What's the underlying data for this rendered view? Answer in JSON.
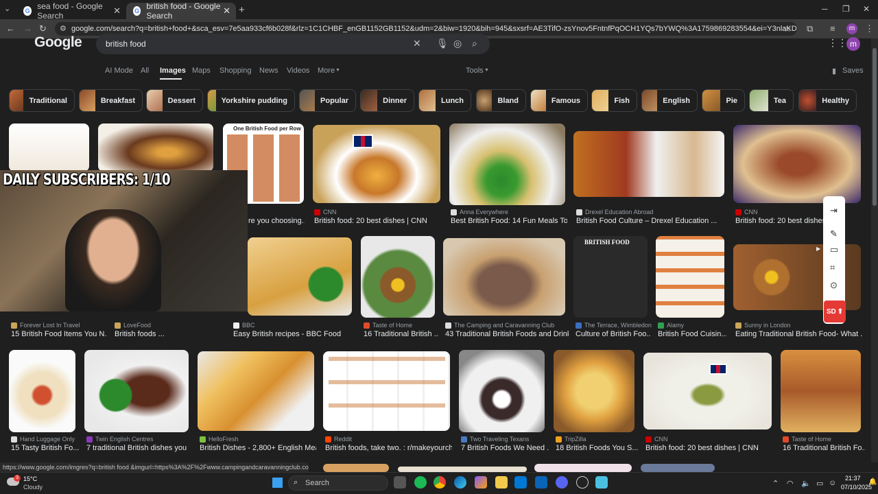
{
  "browser": {
    "tabs": [
      {
        "title": "sea food - Google Search",
        "active": false
      },
      {
        "title": "british food - Google Search",
        "active": true
      }
    ],
    "url": "google.com/search?q=british+food+&sca_esv=7e5aa933cf6b028f&rlz=1C1CHBF_enGB1152GB1152&udm=2&biw=1920&bih=945&sxsrf=AE3TifO-zsYnov5FntnfPqOCH1YQs7bYWQ%3A1759869283554&ei=Y3nlaKDElfKehbIPtYm32Ql&ved=0ahUKE...",
    "profile_initial": "m",
    "status_url": "https://www.google.com/imgres?q=british food &imgurl=https%3A%2F%2Fwww.campingandcaravanningclub.co.uk..."
  },
  "google": {
    "logo": "Google",
    "query": "british food",
    "profile_initial": "m",
    "nav": [
      "AI Mode",
      "All",
      "Images",
      "Maps",
      "Shopping",
      "News",
      "Videos",
      "More"
    ],
    "tools": "Tools",
    "saves": "Saves",
    "chips": [
      "Traditional",
      "Breakfast",
      "Dessert",
      "Yorkshire pudding",
      "Popular",
      "Dinner",
      "Lunch",
      "Bland",
      "Famous",
      "Fish",
      "English",
      "Pie",
      "Tea",
      "Healthy"
    ]
  },
  "results": {
    "row1": [
      {
        "source": "",
        "title": "re you choosing..."
      },
      {
        "source": "CNN",
        "title": "British food: 20 best dishes | CNN"
      },
      {
        "source": "Anna Everywhere",
        "title": "Best British Food: 14 Fun Meals To ..."
      },
      {
        "source": "Drexel Education Abroad",
        "title": "British Food Culture – Drexel Education ..."
      },
      {
        "source": "CNN",
        "title": "British food: 20 best dishes | C"
      }
    ],
    "row1_thumb_texts": [
      "One British Food per Row",
      "BRITISH FOOD"
    ],
    "row2": [
      {
        "source": "Forever Lost In Travel",
        "title": "15 British Food Items You N..."
      },
      {
        "source": "LoveFood",
        "title": "British foods ..."
      },
      {
        "source": "BBC",
        "title": "Easy British recipes - BBC Food"
      },
      {
        "source": "Taste of Home",
        "title": "16 Traditional British ..."
      },
      {
        "source": "The Camping and Caravanning Club",
        "title": "43 Traditional British Foods and Drink..."
      },
      {
        "source": "The Terrace, Wimbledon",
        "title": "Culture of British Foo..."
      },
      {
        "source": "Alamy",
        "title": "British Food Cuisin..."
      },
      {
        "source": "Sunny in London",
        "title": "Eating Traditional British Food- What ..."
      }
    ],
    "row3": [
      {
        "source": "Hand Luggage Only",
        "title": "15 Tasty British Fo..."
      },
      {
        "source": "Twin English Centres",
        "title": "7 traditional British dishes you n..."
      },
      {
        "source": "HelloFresh",
        "title": "British Dishes - 2,800+ English Meal..."
      },
      {
        "source": "Reddit",
        "title": "British foods, take two. : r/makeyourcho..."
      },
      {
        "source": "Two Traveling Texans",
        "title": "7 British Foods We Need ..."
      },
      {
        "source": "TripZilla",
        "title": "18 British Foods You S..."
      },
      {
        "source": "CNN",
        "title": "British food: 20 best dishes | CNN"
      },
      {
        "source": "Taste of Home",
        "title": "16 Traditional British Fo..."
      }
    ]
  },
  "overlay": {
    "webcam_text": "DAILY SUBSCRIBERS: 1/10",
    "sd_button": "SD"
  },
  "taskbar": {
    "weather_temp": "15°C",
    "weather_desc": "Cloudy",
    "weather_badge": "3",
    "search_placeholder": "Search",
    "time": "21:37",
    "date": "07/10/2025"
  }
}
